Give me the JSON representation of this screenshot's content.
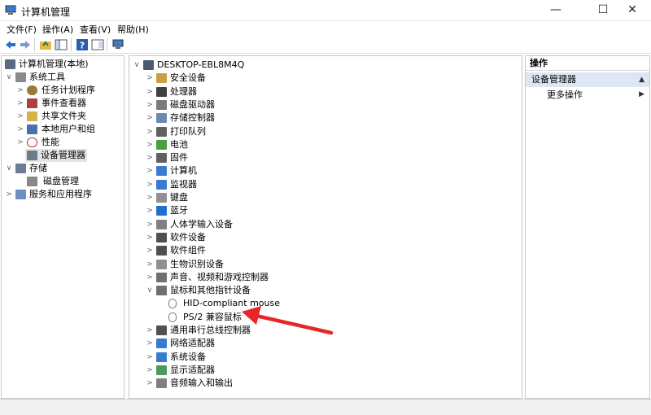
{
  "window": {
    "title": "计算机管理",
    "minimize": "—",
    "maximize": "☐",
    "close": "✕"
  },
  "menu": [
    "文件(F)",
    "操作(A)",
    "查看(V)",
    "帮助(H)"
  ],
  "left_tree": [
    {
      "label": "计算机管理(本地)",
      "expander": "",
      "color": "#5a6a80"
    },
    {
      "label": "系统工具",
      "expander": "∨",
      "color": "#8a8a8a"
    },
    {
      "label": "任务计划程序",
      "expander": ">",
      "color": "#9a7a3a"
    },
    {
      "label": "事件查看器",
      "expander": ">",
      "color": "#b04040"
    },
    {
      "label": "共享文件夹",
      "expander": ">",
      "color": "#d6b24a"
    },
    {
      "label": "本地用户和组",
      "expander": ">",
      "color": "#4a70b0"
    },
    {
      "label": "性能",
      "expander": ">",
      "color": "#c03030"
    },
    {
      "label": "设备管理器",
      "expander": "",
      "color": "#707a88",
      "selected": true
    },
    {
      "label": "存储",
      "expander": "∨",
      "color": "#6a7c96"
    },
    {
      "label": "磁盘管理",
      "expander": "",
      "color": "#888888"
    },
    {
      "label": "服务和应用程序",
      "expander": ">",
      "color": "#6c8fc0"
    }
  ],
  "center": {
    "root": "DESKTOP-EBL8M4Q",
    "items": [
      {
        "label": "安全设备",
        "color": "#c9a040"
      },
      {
        "label": "处理器",
        "color": "#404040"
      },
      {
        "label": "磁盘驱动器",
        "color": "#7a7a7a"
      },
      {
        "label": "存储控制器",
        "color": "#6a8ab0"
      },
      {
        "label": "打印队列",
        "color": "#606060"
      },
      {
        "label": "电池",
        "color": "#4aa040"
      },
      {
        "label": "固件",
        "color": "#606060"
      },
      {
        "label": "计算机",
        "color": "#3a7ad0"
      },
      {
        "label": "监视器",
        "color": "#3a7ad0"
      },
      {
        "label": "键盘",
        "color": "#909090"
      },
      {
        "label": "蓝牙",
        "color": "#1f6fd0"
      },
      {
        "label": "人体学输入设备",
        "color": "#808080"
      },
      {
        "label": "软件设备",
        "color": "#505050"
      },
      {
        "label": "软件组件",
        "color": "#505050"
      },
      {
        "label": "生物识别设备",
        "color": "#909090"
      },
      {
        "label": "声音、视频和游戏控制器",
        "color": "#707070"
      },
      {
        "label": "鼠标和其他指针设备",
        "color": "#707070",
        "expanded": true
      },
      {
        "label": "通用串行总线控制器",
        "color": "#505050"
      },
      {
        "label": "网络适配器",
        "color": "#3a7ad0"
      },
      {
        "label": "系统设备",
        "color": "#3a7ad0"
      },
      {
        "label": "显示适配器",
        "color": "#4a9a60"
      },
      {
        "label": "音频输入和输出",
        "color": "#808080"
      }
    ],
    "mouse_children": [
      "HID-compliant mouse",
      "PS/2 兼容鼠标"
    ]
  },
  "actions": {
    "header": "操作",
    "section": "设备管理器",
    "more": "更多操作",
    "section_arrow": "▲",
    "more_arrow": "▶"
  },
  "annotation_color": "#e8262a"
}
